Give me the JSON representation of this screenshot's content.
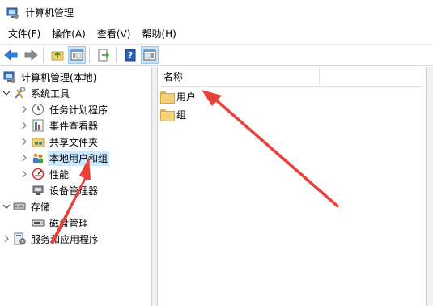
{
  "window": {
    "title": "计算机管理"
  },
  "menu": [
    {
      "label": "文件(F)"
    },
    {
      "label": "操作(A)"
    },
    {
      "label": "查看(V)"
    },
    {
      "label": "帮助(H)"
    }
  ],
  "toolbar": {
    "buttons": [
      "back-arrow-icon",
      "forward-arrow-icon",
      "up-folder-icon",
      "show-hide-tree-icon",
      "export-list-icon",
      "help-icon",
      "show-action-pane-icon"
    ]
  },
  "tree": {
    "root": "计算机管理(本地)",
    "system_tools": "系统工具",
    "task_scheduler": "任务计划程序",
    "event_viewer": "事件查看器",
    "shared_folders": "共享文件夹",
    "local_users_groups": "本地用户和组",
    "performance": "性能",
    "device_manager": "设备管理器",
    "storage": "存储",
    "disk_management": "磁盘管理",
    "services_apps": "服务和应用程序"
  },
  "list": {
    "column_name": "名称",
    "items": [
      "用户",
      "组"
    ]
  },
  "colors": {
    "selection": "#cce8ff",
    "annotation_arrow": "#e8413a",
    "folder": "#f5d27a"
  }
}
